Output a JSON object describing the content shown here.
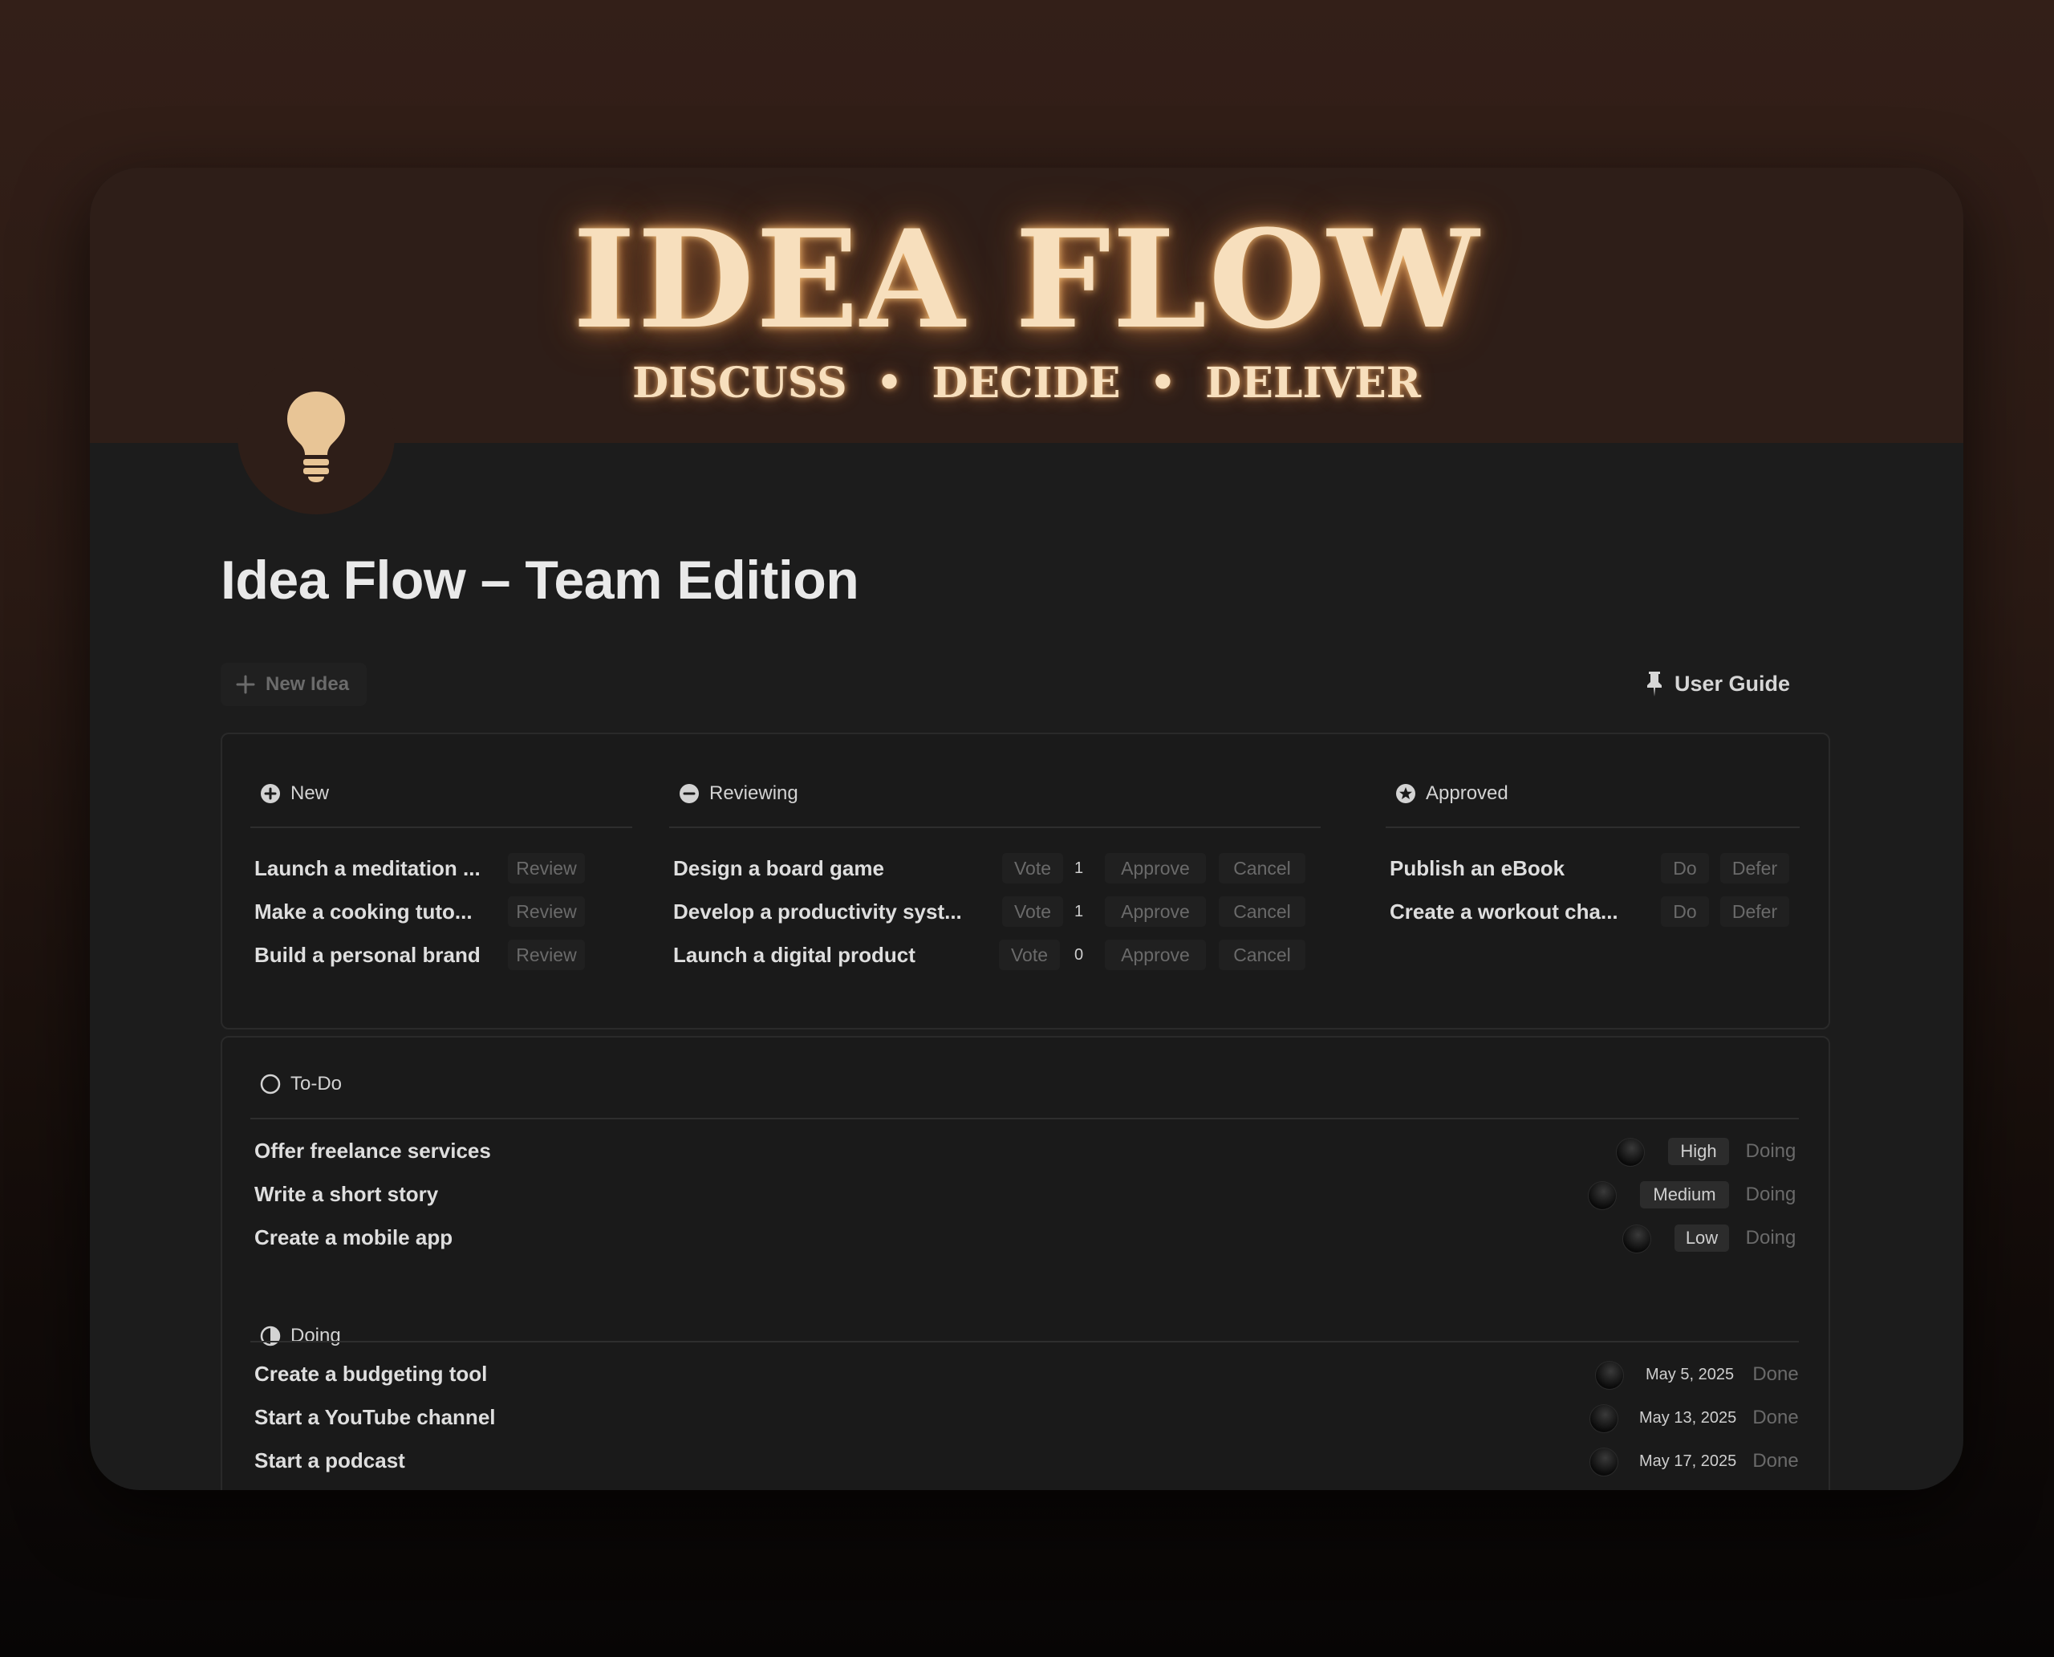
{
  "banner": {
    "title": "IDEA FLOW",
    "subtitle": "DISCUSS  •  DECIDE  •  DELIVER",
    "icon": "lightbulb-icon"
  },
  "page": {
    "title": "Idea Flow – Team Edition"
  },
  "toolbar": {
    "new_idea_label": "New Idea",
    "user_guide_label": "User Guide"
  },
  "board": {
    "new": {
      "label": "New",
      "icon": "plus-circle-icon",
      "items": [
        {
          "title": "Launch a meditation ...",
          "action": "Review"
        },
        {
          "title": "Make a cooking tuto...",
          "action": "Review"
        },
        {
          "title": "Build a personal brand",
          "action": "Review"
        }
      ]
    },
    "reviewing": {
      "label": "Reviewing",
      "icon": "minus-circle-icon",
      "items": [
        {
          "title": "Design a board game",
          "vote": "Vote",
          "votes": "1",
          "approve": "Approve",
          "cancel": "Cancel"
        },
        {
          "title": "Develop a productivity syst...",
          "vote": "Vote",
          "votes": "1",
          "approve": "Approve",
          "cancel": "Cancel"
        },
        {
          "title": "Launch a digital product",
          "vote": "Vote",
          "votes": "0",
          "approve": "Approve",
          "cancel": "Cancel"
        }
      ]
    },
    "approved": {
      "label": "Approved",
      "icon": "star-circle-icon",
      "items": [
        {
          "title": "Publish an eBook",
          "do": "Do",
          "defer": "Defer"
        },
        {
          "title": "Create a workout cha...",
          "do": "Do",
          "defer": "Defer"
        }
      ]
    }
  },
  "todo": {
    "label": "To-Do",
    "icon": "empty-circle-icon",
    "items": [
      {
        "title": "Offer freelance services",
        "priority": "High",
        "status": "Doing"
      },
      {
        "title": "Write a short story",
        "priority": "Medium",
        "status": "Doing"
      },
      {
        "title": "Create a mobile app",
        "priority": "Low",
        "status": "Doing"
      }
    ]
  },
  "doing": {
    "label": "Doing",
    "icon": "half-circle-icon",
    "items": [
      {
        "title": "Create a budgeting tool",
        "date": "May 5, 2025",
        "status": "Done"
      },
      {
        "title": "Start a YouTube channel",
        "date": "May 13, 2025",
        "status": "Done"
      },
      {
        "title": "Start a podcast",
        "date": "May 17, 2025",
        "status": "Done"
      }
    ]
  },
  "colors": {
    "banner_bg": "#2e1e18",
    "glow_text": "#f7dfbd",
    "bulb": "#e8c596",
    "card_bg": "#1c1c1c"
  }
}
